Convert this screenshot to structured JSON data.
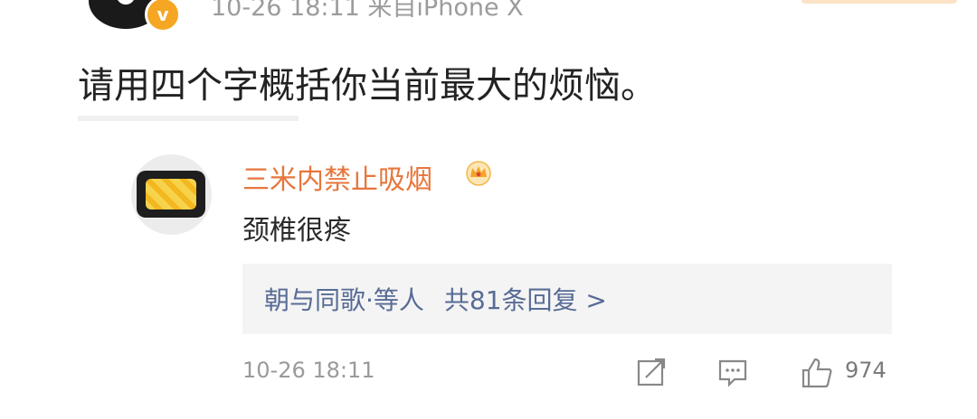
{
  "post": {
    "meta": "10-26 18:11 来自iPhone X",
    "badge": "v",
    "text": "请用四个字概括你当前最大的烦恼。"
  },
  "comment": {
    "author": "三米内禁止吸烟",
    "text": "颈椎很疼",
    "reply_names": "朝与同歌·等人",
    "reply_count": "共81条回复 >",
    "time": "10-26 18:11",
    "like_count": "974"
  },
  "colors": {
    "name": "#e7763c",
    "link": "#576b95",
    "meta": "#9a9a9a"
  },
  "icons": [
    "crown-icon",
    "share-icon",
    "comment-icon",
    "like-icon"
  ]
}
